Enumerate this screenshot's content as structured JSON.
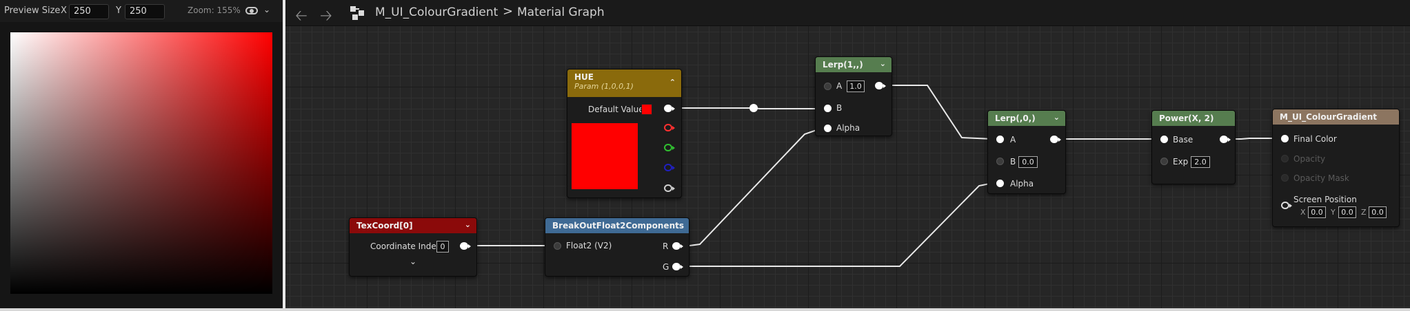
{
  "preview": {
    "size_label": "Preview Size",
    "x_label": "X",
    "x_value": "250",
    "y_label": "Y",
    "y_value": "250",
    "zoom": "Zoom: 155%"
  },
  "toolbar": {
    "breadcrumb_asset": "M_UI_ColourGradient",
    "breadcrumb_sep": ">",
    "breadcrumb_graph": "Material Graph"
  },
  "nodes": {
    "hue": {
      "title": "HUE",
      "subtitle": "Param (1,0,0,1)",
      "default_label": "Default Value",
      "color": "#ff0000"
    },
    "texcoord": {
      "title": "TexCoord[0]",
      "index_label": "Coordinate Index",
      "index_value": "0"
    },
    "breakout": {
      "title": "BreakOutFloat2Components",
      "input_label": "Float2 (V2)",
      "out_r": "R",
      "out_g": "G"
    },
    "lerp1": {
      "title": "Lerp(1,,)",
      "a_label": "A",
      "a_value": "1.0",
      "b_label": "B",
      "alpha_label": "Alpha"
    },
    "lerp2": {
      "title": "Lerp(,0,)",
      "a_label": "A",
      "b_label": "B",
      "b_value": "0.0",
      "alpha_label": "Alpha"
    },
    "power": {
      "title": "Power(X, 2)",
      "base_label": "Base",
      "exp_label": "Exp",
      "exp_value": "2.0"
    },
    "result": {
      "title": "M_UI_ColourGradient",
      "final_color": "Final Color",
      "opacity": "Opacity",
      "opacity_mask": "Opacity Mask",
      "screen_position": "Screen Position",
      "x_label": "X",
      "x_value": "0.0",
      "y_label": "Y",
      "y_value": "0.0",
      "z_label": "Z",
      "z_value": "0.0"
    }
  },
  "colors": {
    "param_header": "#8a6a0c",
    "texcoord_header": "#8b0a0a",
    "breakout_header": "#3f6a94",
    "math_header": "#567d4f",
    "result_header": "#8c7560",
    "preview_gradient_hue": "#ff0000"
  }
}
